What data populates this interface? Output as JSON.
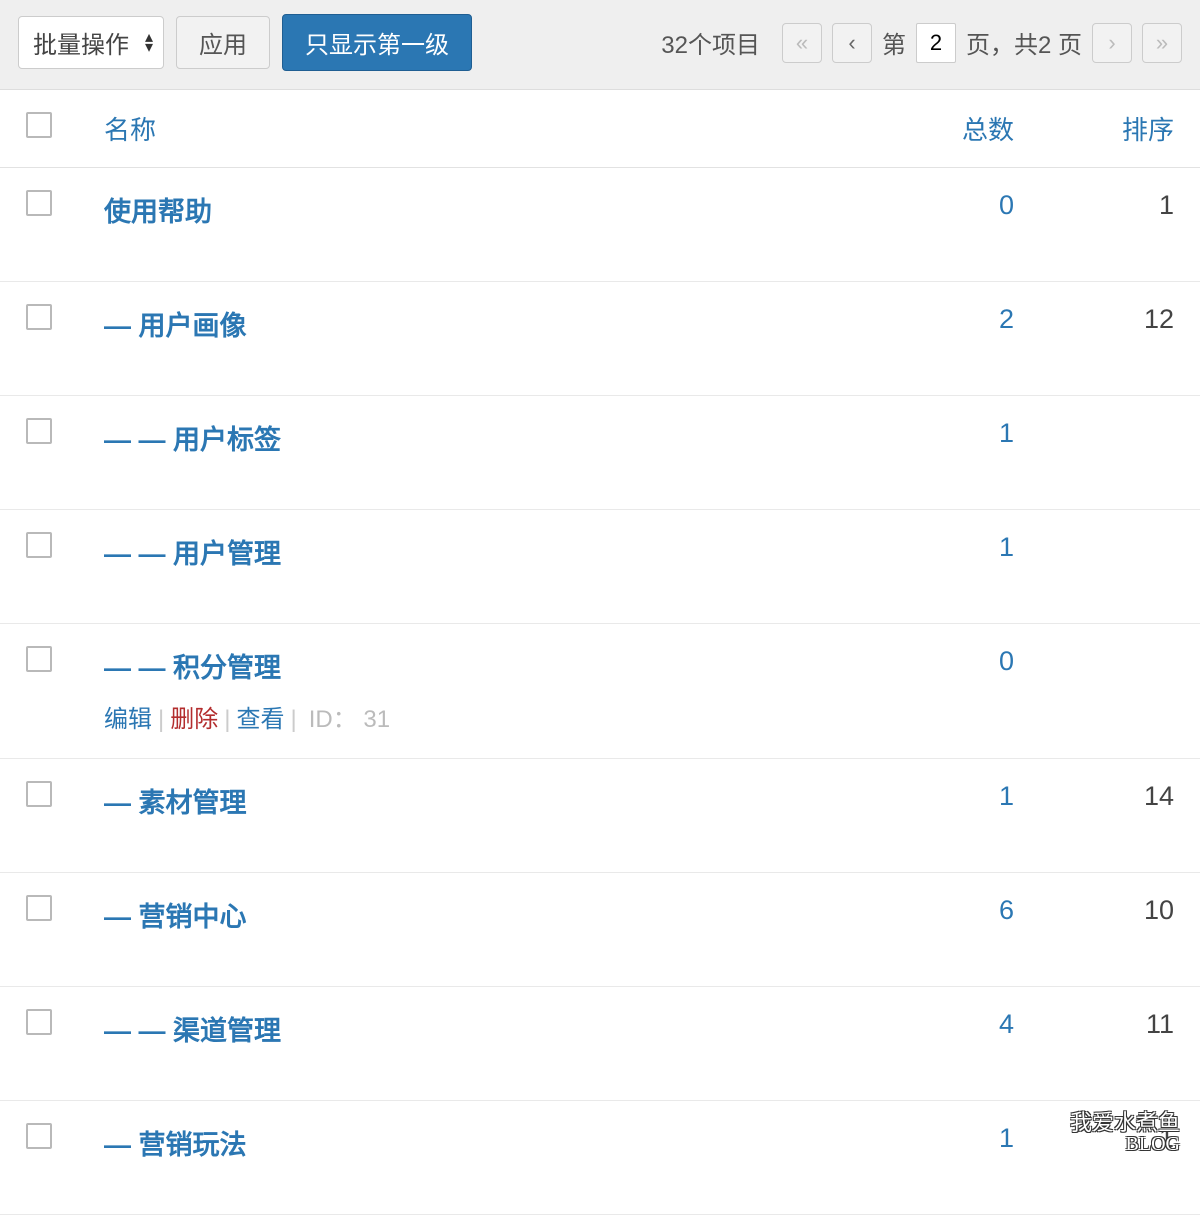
{
  "toolbar": {
    "bulk_label": "批量操作",
    "apply_label": "应用",
    "filter_label": "只显示第一级"
  },
  "pagination": {
    "items_text": "32个项目",
    "prefix": "第",
    "current": "2",
    "suffix": "页，共2 页"
  },
  "columns": {
    "name": "名称",
    "count": "总数",
    "sort": "排序"
  },
  "row_actions": {
    "edit": "编辑",
    "delete": "删除",
    "view": "查看",
    "id_label": "ID："
  },
  "rows": [
    {
      "name": "使用帮助",
      "count": "0",
      "sort": "1",
      "show_actions": false
    },
    {
      "name": "— 用户画像",
      "count": "2",
      "sort": "12",
      "show_actions": false
    },
    {
      "name": "— — 用户标签",
      "count": "1",
      "sort": "",
      "show_actions": false
    },
    {
      "name": "— — 用户管理",
      "count": "1",
      "sort": "",
      "show_actions": false
    },
    {
      "name": "— — 积分管理",
      "count": "0",
      "sort": "",
      "show_actions": true,
      "id": "31"
    },
    {
      "name": "— 素材管理",
      "count": "1",
      "sort": "14",
      "show_actions": false
    },
    {
      "name": "— 营销中心",
      "count": "6",
      "sort": "10",
      "show_actions": false
    },
    {
      "name": "— — 渠道管理",
      "count": "4",
      "sort": "11",
      "show_actions": false
    },
    {
      "name": "— 营销玩法",
      "count": "1",
      "sort": "1",
      "show_actions": false
    }
  ],
  "watermark": {
    "line1": "我爱水煮鱼",
    "line2": "BLOG"
  }
}
